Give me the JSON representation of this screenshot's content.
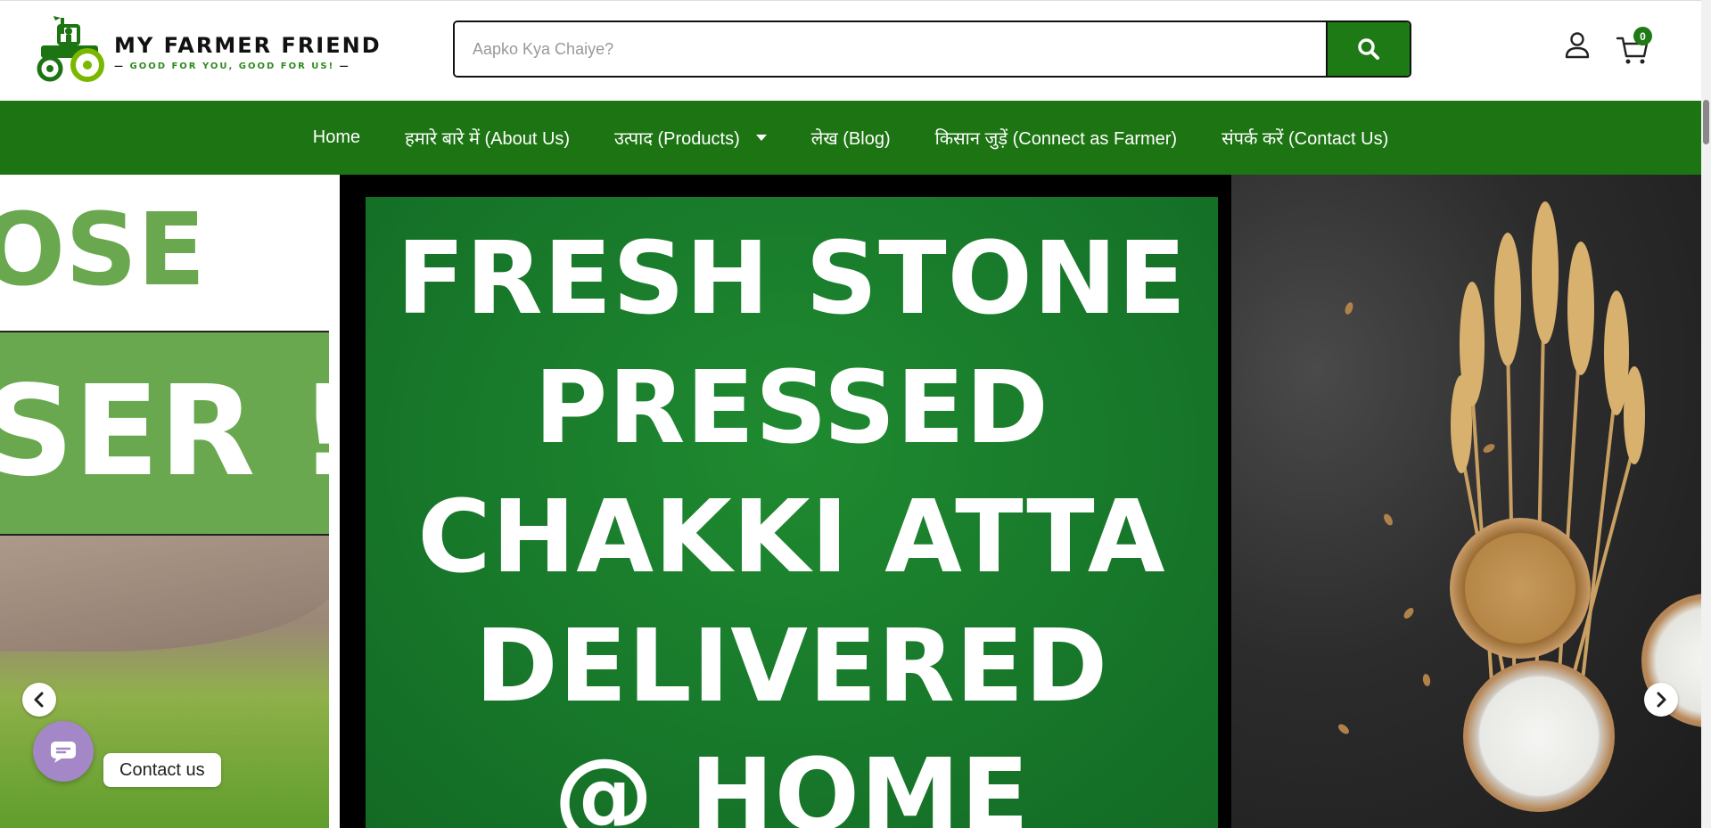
{
  "brand": {
    "name": "MY FARMER FRIEND",
    "tagline_prefix": "—",
    "tagline": "GOOD FOR YOU, GOOD FOR US!",
    "tagline_suffix": "—",
    "accent_color": "#1d7413"
  },
  "search": {
    "placeholder": "Aapko Kya Chaiye?",
    "value": "",
    "button_icon": "search-icon"
  },
  "account": {
    "user_icon": "user-icon",
    "cart_icon": "cart-icon",
    "cart_count": "0"
  },
  "nav": {
    "items": [
      {
        "label": "Home"
      },
      {
        "label": "हमारे बारे में (About Us)"
      },
      {
        "label": "उत्पाद (Products)",
        "has_dropdown": true
      },
      {
        "label": "लेख (Blog)"
      },
      {
        "label": "किसान जुड़ें (Connect as Farmer)"
      },
      {
        "label": "संपर्क करें (Contact Us)"
      }
    ]
  },
  "slider": {
    "prev_slide": {
      "top_text": "OSE",
      "band_text": "SER !"
    },
    "current_slide": {
      "lines": [
        "FRESH STONE",
        "PRESSED",
        "CHAKKI ATTA",
        "DELIVERED",
        "@ HOME"
      ]
    },
    "prev_arrow_icon": "chevron-left-icon",
    "next_arrow_icon": "chevron-right-icon"
  },
  "contact_widget": {
    "label": "Contact us",
    "icon": "chat-icon"
  }
}
